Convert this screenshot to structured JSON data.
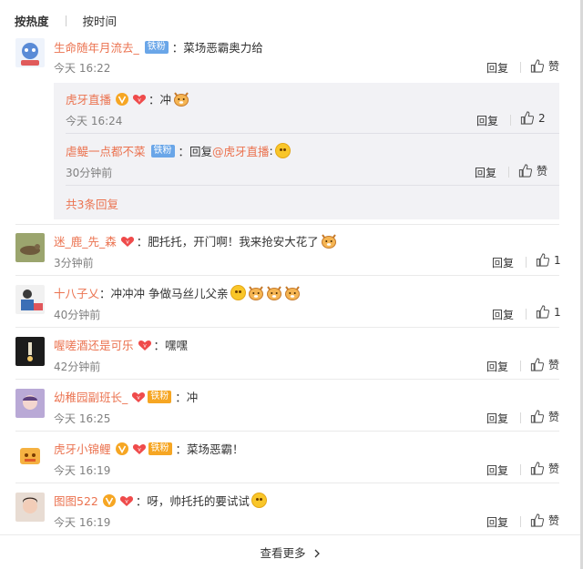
{
  "sort": {
    "hot": "按热度",
    "time": "按时间"
  },
  "labels": {
    "reply": "回复",
    "like": "赞",
    "fans_badge": "铁粉",
    "see_more": "查看更多",
    "more_replies": "共3条回复"
  },
  "comments": [
    {
      "name": "生命随年月流去_",
      "text": "：菜场恶霸奥力给",
      "time": "今天 16:22",
      "likes": "赞"
    },
    {
      "name": "迷_鹿_先_森",
      "text": "：肥托托，开门啊！我来抢安大花了",
      "time": "3分钟前",
      "likes": "1"
    },
    {
      "name": "十八子乂",
      "text": "：冲冲冲 争做马丝儿父亲",
      "time": "40分钟前",
      "likes": "1"
    },
    {
      "name": "喔嗟酒还是可乐",
      "text": "：嘿嘿",
      "time": "42分钟前",
      "likes": "赞"
    },
    {
      "name": "幼稚园副班长_",
      "text": "：冲",
      "time": "今天 16:25",
      "likes": "赞"
    },
    {
      "name": "虎牙小锦鲤",
      "text": "：菜场恶霸！",
      "time": "今天 16:19",
      "likes": "赞"
    },
    {
      "name": "图图522",
      "text": "：呀，帅托托的要试试",
      "time": "今天 16:19",
      "likes": "赞"
    }
  ],
  "replies": [
    {
      "name": "虎牙直播",
      "text": "：冲",
      "time": "今天 16:24",
      "likes": "2"
    },
    {
      "name": "虐鳀一点都不菜",
      "prefix": "：回复",
      "mention": "@虎牙直播",
      "text": ":",
      "time": "30分钟前",
      "likes": "赞"
    }
  ],
  "colors": {
    "accent": "#eb7350",
    "fans_badge": "#6aa6e8",
    "reply_bg": "#f2f2f5"
  }
}
